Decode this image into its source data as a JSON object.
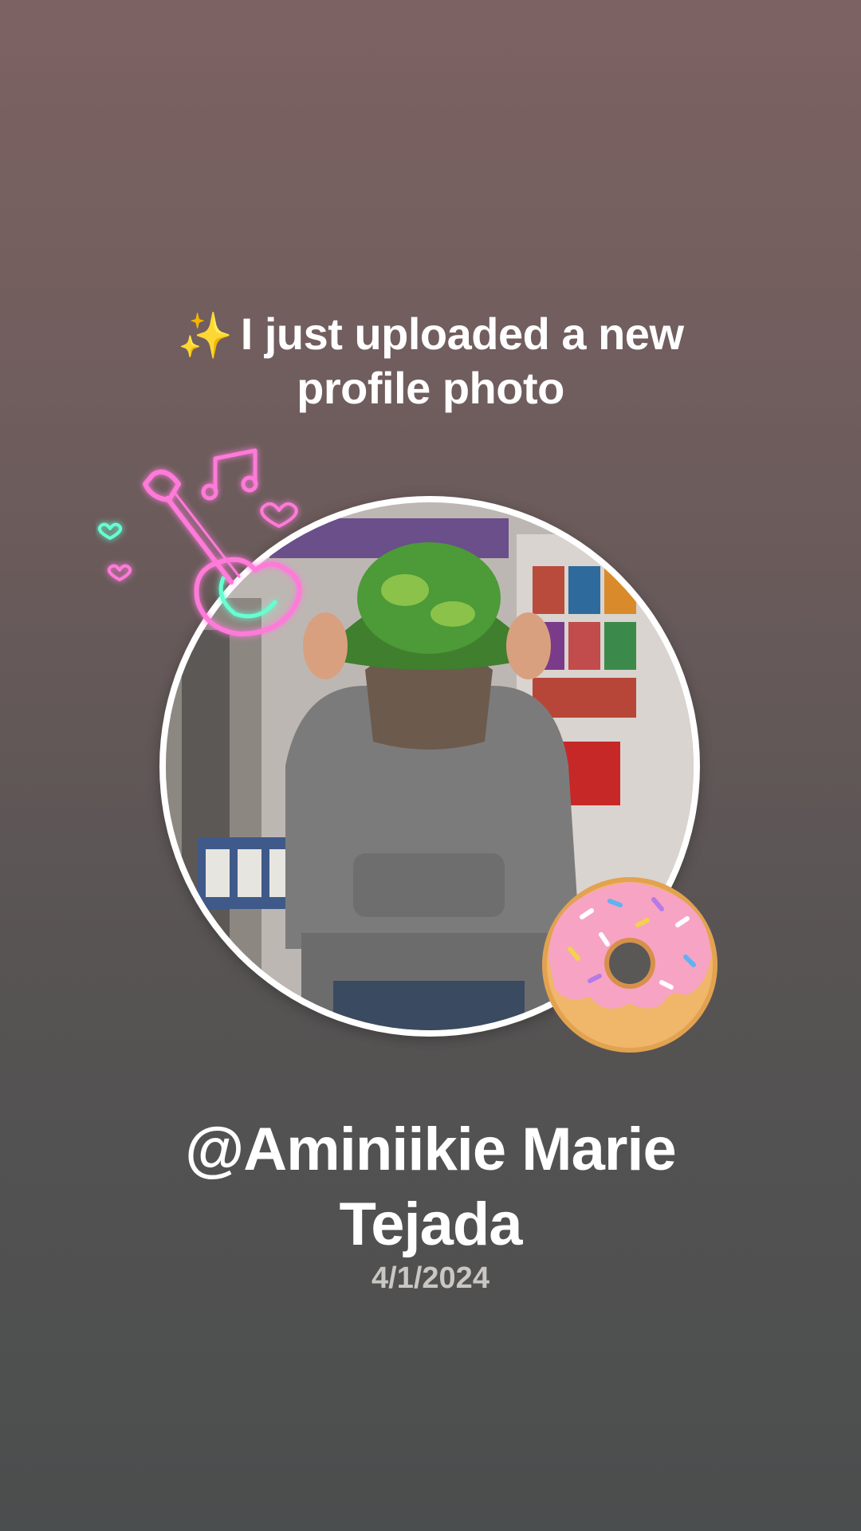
{
  "post": {
    "sparkle_icon": "✨",
    "headline": "I just uploaded a new profile photo",
    "username": "@Aminiikie Marie Tejada",
    "date": "4/1/2024"
  },
  "stickers": {
    "left": "neon-guitar-icon",
    "right": "donut-icon"
  },
  "colors": {
    "background_top": "#7d6262",
    "background_bottom": "#4b4e4e",
    "text": "#ffffff",
    "date_text": "#c9c6c4",
    "ring": "#ffffff",
    "sparkle": "#f4c542"
  }
}
